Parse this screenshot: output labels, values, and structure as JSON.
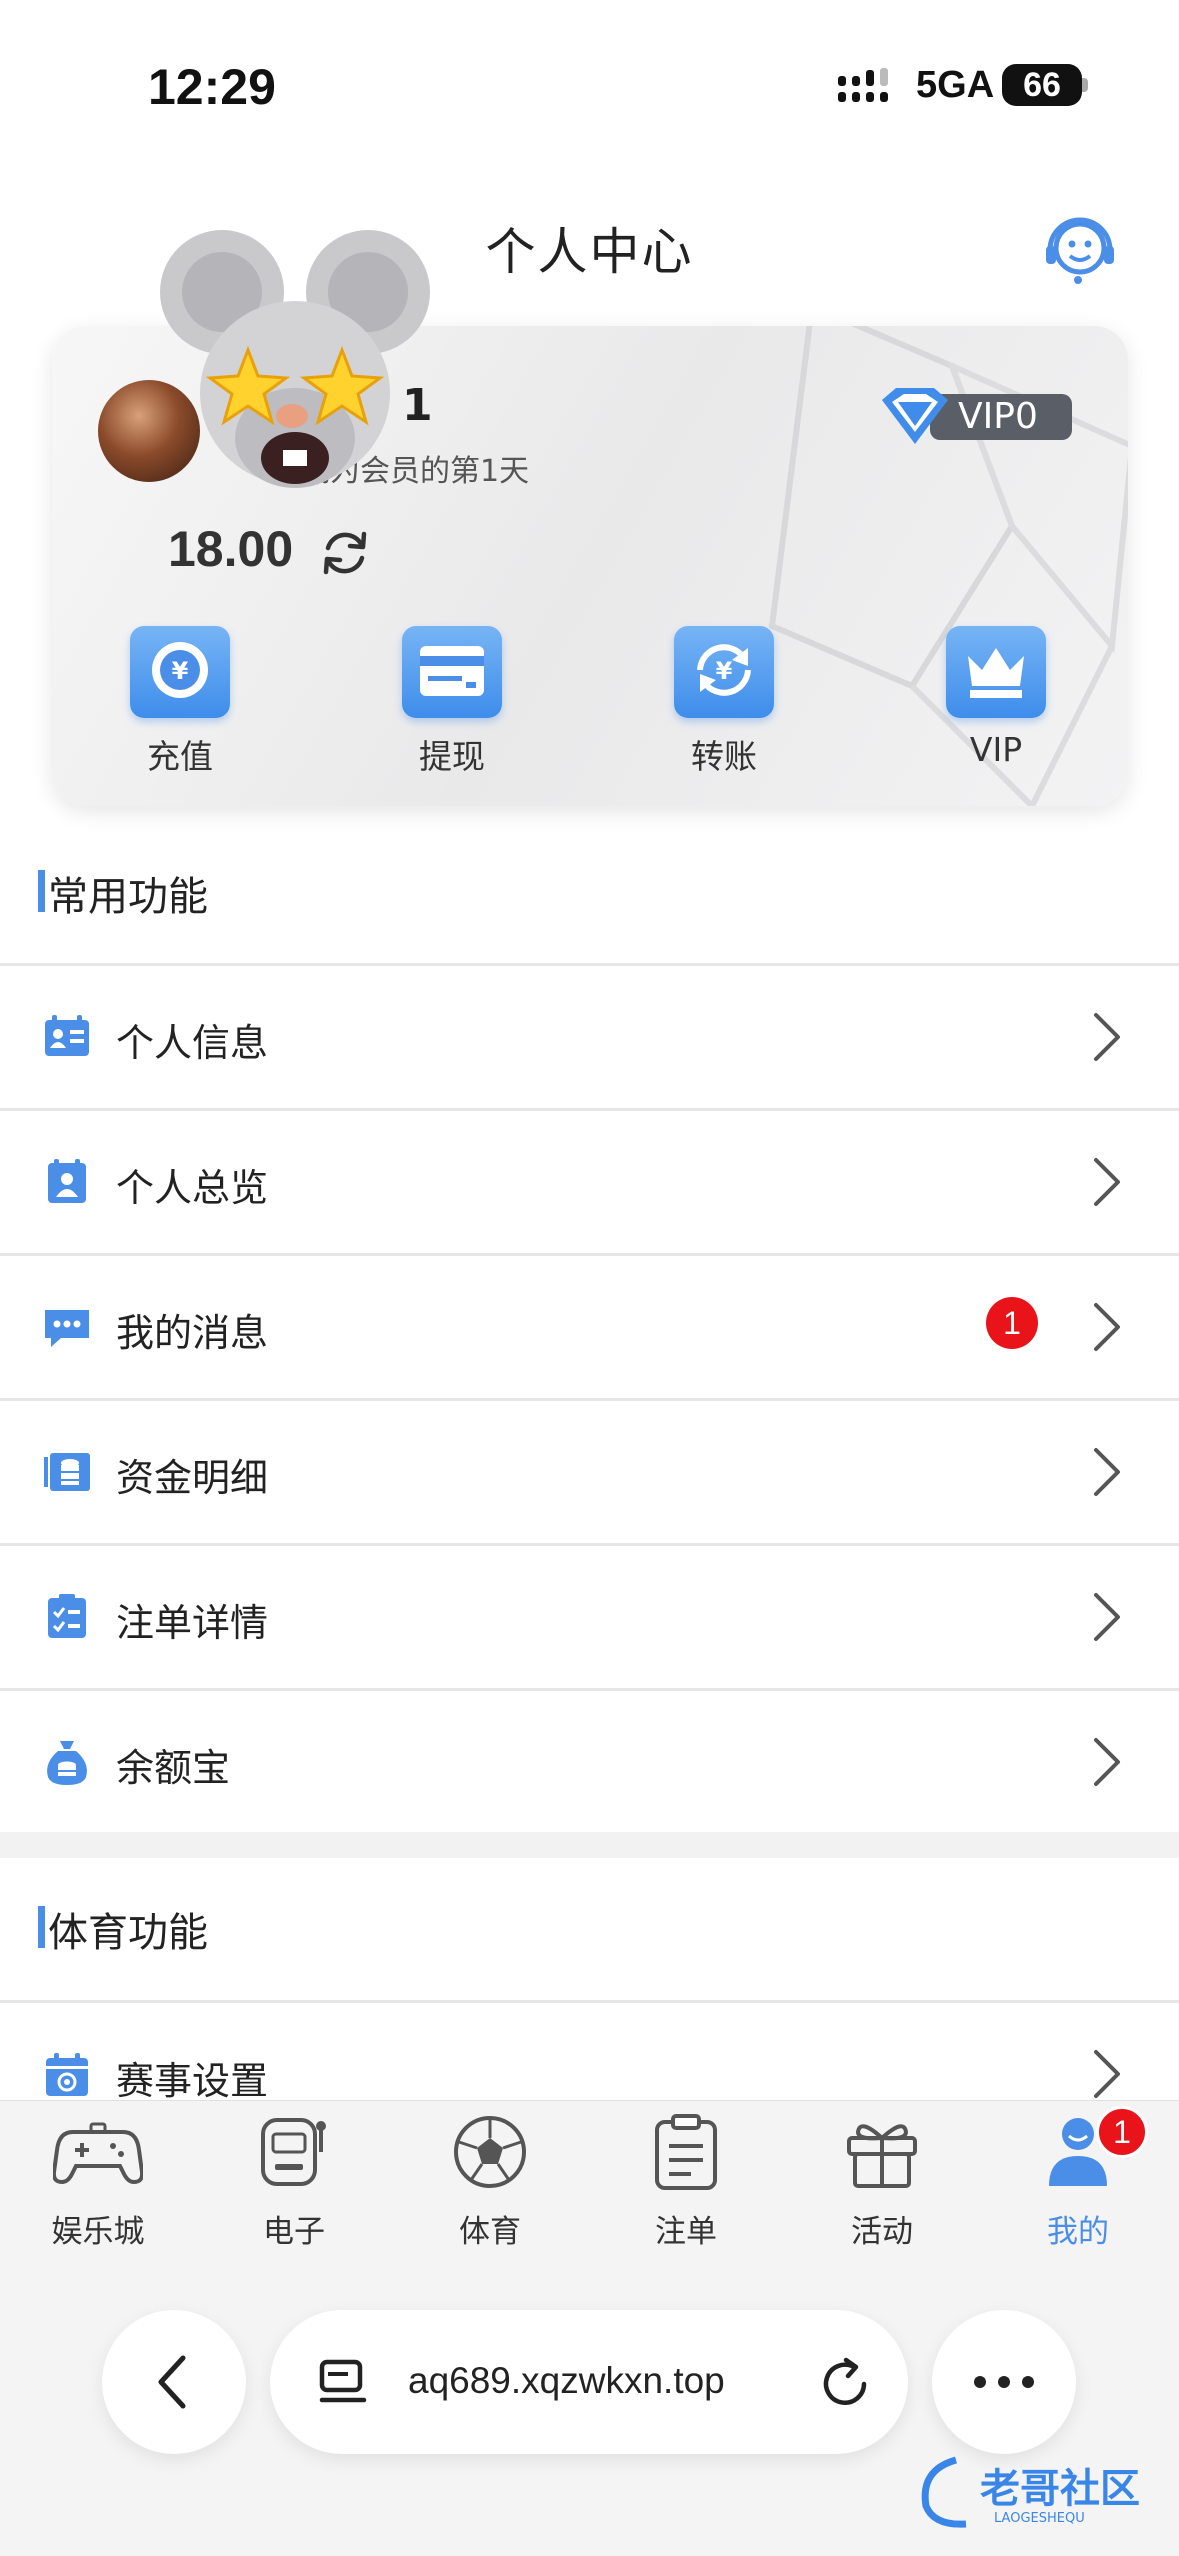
{
  "status_bar": {
    "time": "12:29",
    "network": "5GA",
    "battery": "66"
  },
  "header": {
    "title": "个人中心",
    "icons": [
      "customer-service-icon"
    ]
  },
  "profile": {
    "username": "1",
    "member_days": "成为会员的第1天",
    "vip_level": "VIP0",
    "balance": "18.00"
  },
  "quick_actions": [
    {
      "label": "充值",
      "icon": "deposit-yen-icon"
    },
    {
      "label": "提现",
      "icon": "withdraw-card-icon"
    },
    {
      "label": "转账",
      "icon": "transfer-yen-icon"
    },
    {
      "label": "VIP",
      "icon": "vip-crown-icon"
    }
  ],
  "common_section": {
    "title": "常用功能",
    "rows": [
      {
        "label": "个人信息",
        "icon": "id-card-icon"
      },
      {
        "label": "个人总览",
        "icon": "profile-overview-icon"
      },
      {
        "label": "我的消息",
        "icon": "message-icon",
        "badge": "1"
      },
      {
        "label": "资金明细",
        "icon": "funds-detail-icon"
      },
      {
        "label": "注单详情",
        "icon": "bet-detail-icon"
      },
      {
        "label": "余额宝",
        "icon": "money-bag-icon"
      }
    ]
  },
  "sports_section": {
    "title": "体育功能",
    "rows": [
      {
        "label": "赛事设置",
        "icon": "event-calendar-icon"
      }
    ]
  },
  "tab_bar": {
    "items": [
      {
        "label": "娱乐城",
        "icon": "gamepad-icon"
      },
      {
        "label": "电子",
        "icon": "slot-machine-icon"
      },
      {
        "label": "体育",
        "icon": "soccer-ball-icon"
      },
      {
        "label": "注单",
        "icon": "clipboard-icon"
      },
      {
        "label": "活动",
        "icon": "gift-icon"
      },
      {
        "label": "我的",
        "icon": "user-icon",
        "badge": "1",
        "active": true
      }
    ],
    "accent_color": "#4a8ee8"
  },
  "browser": {
    "url": "aq689.xqzwkxn.top"
  },
  "watermark": {
    "text": "老哥社区",
    "subtext": "LAOGESHEQU"
  }
}
